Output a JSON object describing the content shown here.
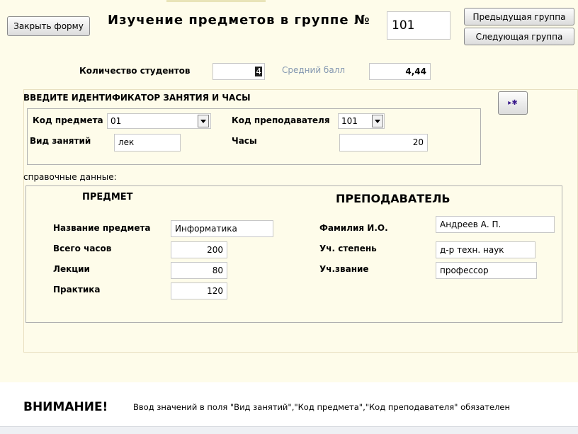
{
  "header": {
    "close_button": "Закрыть форму",
    "title": "Изучение предметов в группе №",
    "group_number": "101",
    "prev_group_button": "Предыдущая группа",
    "next_group_button": "Следующая группа"
  },
  "stats": {
    "students_label": "Количество студентов",
    "students_value": "4",
    "avg_label": "Средний балл",
    "avg_value": "4,44"
  },
  "lesson": {
    "section_title": "ВВЕДИТЕ ИДЕНТИФИКАТОР ЗАНЯТИЯ И ЧАСЫ",
    "subject_code_label": "Код предмета",
    "subject_code_value": "01",
    "teacher_code_label": "Код преподавателя",
    "teacher_code_value": "101",
    "lesson_type_label": "Вид занятий",
    "lesson_type_value": "лек",
    "hours_label": "Часы",
    "hours_value": "20",
    "new_record_icon": "new-record-icon"
  },
  "reference": {
    "caption": "справочные данные:",
    "subject_header": "ПРЕДМЕТ",
    "subject_name_label": "Название предмета",
    "subject_name_value": "Информатика",
    "total_hours_label": "Всего часов",
    "total_hours_value": "200",
    "lectures_label": "Лекции",
    "lectures_value": "80",
    "practice_label": "Практика",
    "practice_value": "120",
    "teacher_header": "ПРЕПОДАВАТЕЛЬ",
    "teacher_name_label": "Фамилия И.О.",
    "teacher_name_value": "Андреев А. П.",
    "degree_label": "Уч. степень",
    "degree_value": "д-р техн. наук",
    "rank_label": "Уч.звание",
    "rank_value": "профессор"
  },
  "footer": {
    "warning_title": "ВНИМАНИЕ!",
    "warning_text": "Ввод значений в поля \"Вид занятий\",\"Код предмета\",\"Код преподавателя\" обязателен"
  },
  "colors": {
    "background": "#fefcea",
    "muted_label": "#8497b0",
    "border": "#b0b0b0"
  }
}
